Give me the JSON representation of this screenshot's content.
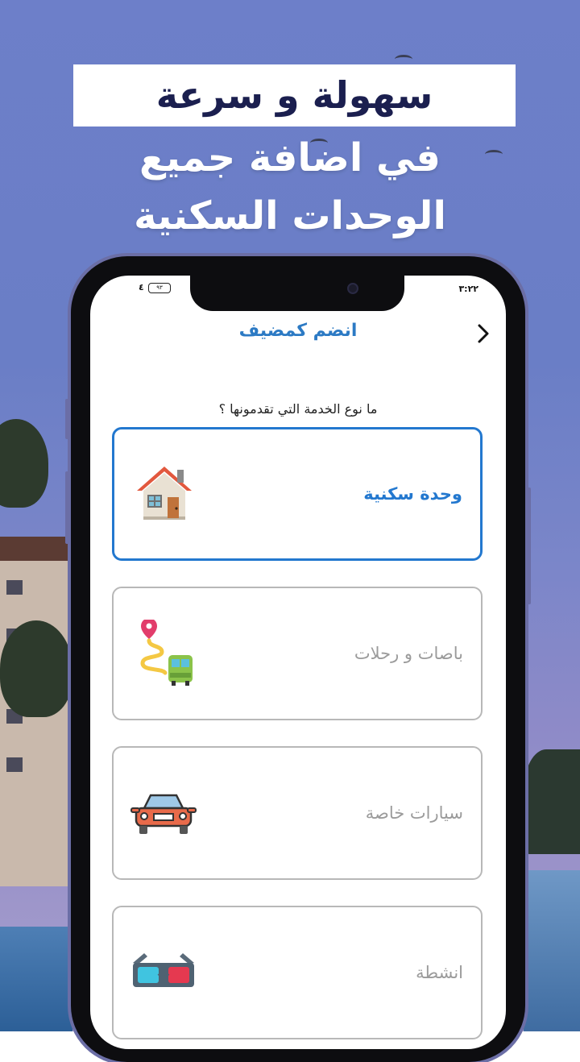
{
  "headline": {
    "banner": "سهولة و سرعة",
    "line1": "في اضافة جميع",
    "line2": "الوحدات السكنية"
  },
  "status_bar": {
    "time": "٣:٢٢",
    "battery": "٩٣",
    "signal": "٤"
  },
  "screen": {
    "title": "انضم كمضيف",
    "back_icon": "chevron-right-icon",
    "question": "ما نوع الخدمة التي تقدمونها ؟",
    "options": [
      {
        "label": "وحدة سكنية",
        "icon": "house-icon",
        "selected": true
      },
      {
        "label": "باصات و رحلات",
        "icon": "bus-route-icon",
        "selected": false
      },
      {
        "label": "سيارات خاصة",
        "icon": "car-icon",
        "selected": false
      },
      {
        "label": "انشطة",
        "icon": "3d-glasses-icon",
        "selected": false
      }
    ]
  },
  "colors": {
    "accent": "#2378cf",
    "title": "#2c7ac4",
    "banner_text": "#1b1f4f"
  }
}
